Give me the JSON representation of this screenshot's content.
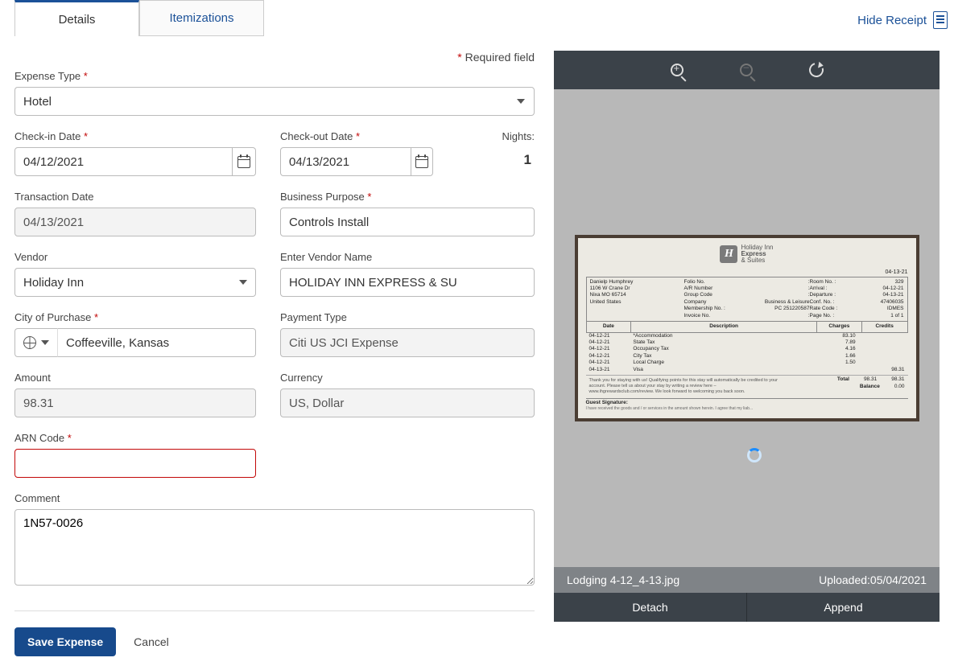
{
  "tabs": {
    "details": "Details",
    "itemizations": "Itemizations"
  },
  "header": {
    "hide_receipt": "Hide Receipt",
    "required": "Required field"
  },
  "labels": {
    "expense_type": "Expense Type",
    "checkin": "Check-in Date",
    "checkout": "Check-out Date",
    "nights": "Nights:",
    "transaction_date": "Transaction Date",
    "business_purpose": "Business Purpose",
    "vendor": "Vendor",
    "vendor_name": "Enter Vendor Name",
    "city": "City of Purchase",
    "payment_type": "Payment Type",
    "amount": "Amount",
    "currency": "Currency",
    "arn": "ARN Code",
    "comment": "Comment"
  },
  "values": {
    "expense_type": "Hotel",
    "checkin": "04/12/2021",
    "checkout": "04/13/2021",
    "nights": "1",
    "transaction_date": "04/13/2021",
    "business_purpose": "Controls Install",
    "vendor": "Holiday Inn",
    "vendor_name": "HOLIDAY INN EXPRESS & SU",
    "city": "Coffeeville, Kansas",
    "payment_type": "Citi US JCI Expense",
    "amount": "98.31",
    "currency": "US, Dollar",
    "arn": "",
    "comment": "1N57-0026"
  },
  "actions": {
    "save": "Save Expense",
    "cancel": "Cancel"
  },
  "receipt_panel": {
    "filename": "Lodging 4-12_4-13.jpg",
    "uploaded_label": "Uploaded:",
    "uploaded_date": "05/04/2021",
    "detach": "Detach",
    "append": "Append"
  },
  "receipt": {
    "brand1": "Holiday Inn",
    "brand2": "Express",
    "brand3": "& Suites",
    "date_header": "04-13-21",
    "guest": {
      "name": "Danielp Humphrey",
      "addr1": "1106 W Crane Dr",
      "addr2": "Nixa MO 65714",
      "country": "United States"
    },
    "mid": {
      "folio": "Folio No.",
      "ar": "A/R Number",
      "group": "Group Code",
      "company": "Company",
      "company_v": "Business & Leisure",
      "member": "Membership No. :",
      "member_v": "PC   251220587",
      "invoice": "Invoice No."
    },
    "right": {
      "room": "Room No. :",
      "room_v": "329",
      "arrival": "Arrival :",
      "arrival_v": "04-12-21",
      "depart": "Departure :",
      "depart_v": "04-13-21",
      "conf": "Conf. No. :",
      "conf_v": "47406035",
      "rate": "Rate Code :",
      "rate_v": "IDMES",
      "page": "Page No. :",
      "page_v": "1 of 1"
    },
    "th": {
      "date": "Date",
      "desc": "Description",
      "chg": "Charges",
      "cr": "Credits"
    },
    "rows": [
      {
        "d": "04-12-21",
        "desc": "*Accommodation",
        "chg": "83.10"
      },
      {
        "d": "04-12-21",
        "desc": "State Tax",
        "chg": "7.89"
      },
      {
        "d": "04-12-21",
        "desc": "Occupancy Tax",
        "chg": "4.16"
      },
      {
        "d": "04-12-21",
        "desc": "City Tax",
        "chg": "1.66"
      },
      {
        "d": "04-12-21",
        "desc": "Local Charge",
        "chg": "1.50"
      },
      {
        "d": "04-13-21",
        "desc": "Visa",
        "cr": "98.31"
      }
    ],
    "thanks": "Thank you for staying with us! Qualifying points for this stay will automatically be credited to your account. Please tell us about your stay by writing a review here – www.ihgrewardsclub.com/review. We look forward to welcoming you back soon.",
    "total_lbl": "Total",
    "total_chg": "98.31",
    "total_cr": "98.31",
    "balance_lbl": "Balance",
    "balance": "0.00",
    "guest_sig": "Guest Signature:",
    "disclaimer": "I have received the goods and / or services in the amount shown herein. I agree that my liab..."
  }
}
